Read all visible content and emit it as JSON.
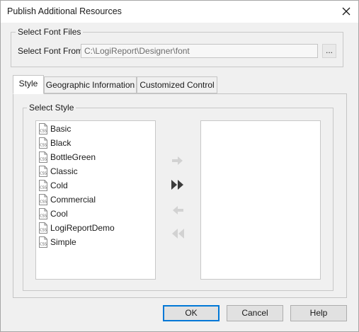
{
  "window": {
    "title": "Publish Additional Resources"
  },
  "font_files": {
    "group_label": "Select Font Files",
    "field_label": "Select Font From:",
    "path_value": "C:\\LogiReport\\Designer\\font",
    "browse_label": "..."
  },
  "tabs": [
    {
      "label": "Style",
      "active": true
    },
    {
      "label": "Geographic Information",
      "active": false
    },
    {
      "label": "Customized Control",
      "active": false
    }
  ],
  "style_panel": {
    "group_label": "Select Style",
    "available_styles": [
      "Basic",
      "Black",
      "BottleGreen",
      "Classic",
      "Cold",
      "Commercial",
      "Cool",
      "LogiReportDemo",
      "Simple"
    ],
    "selected_styles": [],
    "item_icon": "css-file-icon"
  },
  "move_buttons": [
    {
      "name": "add-selected-button",
      "icon": "arrow-right-icon",
      "enabled": false
    },
    {
      "name": "add-all-button",
      "icon": "double-arrow-right-icon",
      "enabled": true
    },
    {
      "name": "remove-selected-button",
      "icon": "arrow-left-icon",
      "enabled": false
    },
    {
      "name": "remove-all-button",
      "icon": "double-arrow-left-icon",
      "enabled": false
    }
  ],
  "footer": {
    "ok_label": "OK",
    "cancel_label": "Cancel",
    "help_label": "Help"
  },
  "colors": {
    "accent": "#0078d7",
    "dialog_bg": "#f0f0f0",
    "enabled_arrow": "#3c3c3c",
    "disabled_arrow": "#d2d2d2"
  }
}
